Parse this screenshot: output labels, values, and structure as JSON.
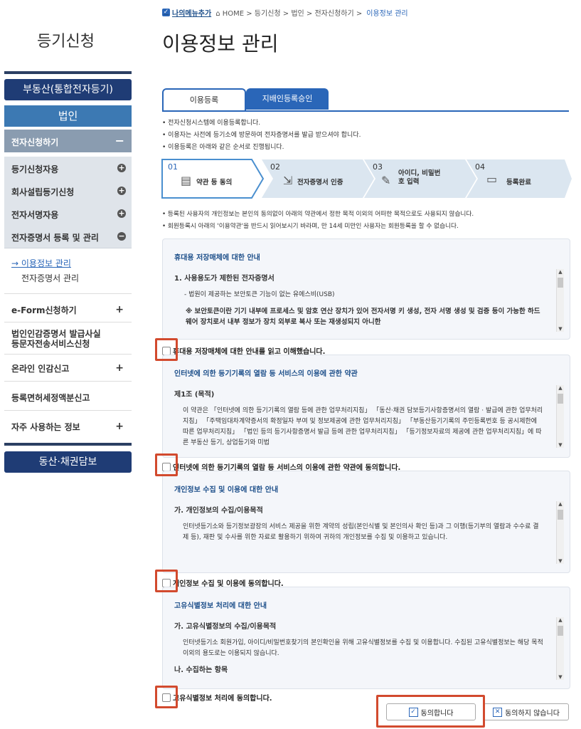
{
  "breadcrumb": {
    "mymenu": "나의메뉴추가",
    "path": "⌂ HOME > 등기신청 > 법인 > 전자신청하기 >",
    "current": "이용정보 관리"
  },
  "sidebar": {
    "title": "등기신청",
    "realestate": "부동산(통합전자등기)",
    "corporate": "법인",
    "esubmit": {
      "label": "전자신청하기",
      "toggle": "−"
    },
    "items": [
      {
        "label": "등기신청자용",
        "icon": "+"
      },
      {
        "label": "회사설립등기신청",
        "icon": "+"
      },
      {
        "label": "전자서명자용",
        "icon": "+"
      },
      {
        "label": "전자증명서 등록 및 관리",
        "icon": "−"
      }
    ],
    "sub": [
      {
        "label": "→ 이용정보 관리"
      },
      {
        "label": "전자증명서 관리"
      }
    ],
    "menus": [
      {
        "label": "e-Form신청하기",
        "plus": "+"
      },
      {
        "label": "법인인감증명서 발급사실\n등문자전송서비스신청",
        "plus": ""
      },
      {
        "label": "온라인 인감신고",
        "plus": "+"
      },
      {
        "label": "등록면허세정액분신고",
        "plus": ""
      },
      {
        "label": "자주 사용하는 정보",
        "plus": "+"
      }
    ],
    "movable": "동산·채권담보"
  },
  "main": {
    "title": "이용정보 관리",
    "tabs": [
      {
        "label": "이용등록"
      },
      {
        "label": "지배인등록승인"
      }
    ],
    "bullets": [
      "• 전자신청시스템에 이용등록합니다.",
      "• 이용자는 사전에 등기소에 방문하여 전자증명서를 발급 받으셔야 합니다.",
      "• 이용등록은 아래와 같은 순서로 진행됩니다."
    ],
    "steps": [
      {
        "num": "01",
        "label": "약관 등 동의",
        "icon": "document-icon"
      },
      {
        "num": "02",
        "label": "전자증명서 인증",
        "icon": "certificate-icon"
      },
      {
        "num": "03",
        "label": "아이디, 비밀번\n호 입력",
        "icon": "pen-icon"
      },
      {
        "num": "04",
        "label": "등록완료",
        "icon": "monitor-icon"
      }
    ],
    "notes": [
      "• 등록된 사용자의 개인정보는 본인의 동의없이 아래의 약관에서 정한 목적 이외의 어떠한 목적으로도 사용되지 않습니다.",
      "• 회원등록시 아래의 '이용약관'을 반드시 읽어보시기 바라며, 만 14세 미만인 사용자는 회원등록을 할 수 없습니다."
    ],
    "boxes": [
      {
        "title": "휴대용 저장매체에 대한 안내",
        "heading": "1. 사용용도가 제한된 전자증명서",
        "lines": [
          "- 법원이 제공하는 보안토큰 기능이 없는 유에스비(USB)"
        ],
        "note": "※ 보안토큰이란 기기 내부에 프로세스 및 암호 연산 장치가 있어 전자서명 키 생성, 전자 서명 생성 및 검증 등이 가능한 하드웨어 장치로서 내부 정보가 장치 외부로 복사 또는 재생성되지 아니한",
        "agree": "휴대용 저장매체에 대한 안내를 읽고 이해했습니다."
      },
      {
        "title": "인터넷에 의한 등기기록의 열람 등 서비스의 이용에 관한 약관",
        "heading": "제1조 (목적)",
        "lines": [
          "이 약관은 「인터넷에 의한 등기기록의 열람 등에 관한 업무처리지침」 「동산·채권 담보등기사항증명서의 열람 · 발급에 관한 업무처리지침」 「주택임대차계약증서의 확정일자 부여 및 정보제공에 관한 업무처리지침」 「부동산등기기록의 주민등록번호 등 공시제한에 따른 업무처리지침」 「법인 등의 등기사항증명서 발급 등에 관한 업무처리지침」 「등기정보자료의 제공에 관한 업무처리지침」에 따른 부동산 등기, 상업등기와 미법"
        ],
        "note": "",
        "agree": "인터넷에 의한 등기기록의 열람 등 서비스의 이용에 관한 약관에 동의합니다."
      },
      {
        "title": "개인정보 수집 및 이용에 대한 안내",
        "heading": "가. 개인정보의 수집/이용목적",
        "lines": [
          "인터넷등기소와 등기정보광장의 서비스 제공을 위한 계약의 성립(본인식별 및 본인의사 확인 등)과 그 이행(등기부의 열람과 수수료 결제 등), 재판 및 수사를 위한 자료로 활용하기 위하여 귀하의 개인정보를 수집 및 이용하고 있습니다."
        ],
        "note": "",
        "agree": "개인정보 수집 및 이용에 동의합니다."
      },
      {
        "title": "고유식별정보 처리에 대한 안내",
        "heading": "가. 고유식별정보의 수집/이용목적",
        "lines": [
          "인터넷등기소 회원가입, 아이디/비밀번호찾기의 본인확인을 위해 고유식별정보를 수집 및 이용합니다. 수집된 고유식별정보는 해당 목적이외의 용도로는 이용되지 않습니다."
        ],
        "note": "나. 수집하는 항목",
        "agree": "고유식별정보 처리에 동의합니다."
      }
    ],
    "agree_btn": "동의합니다",
    "disagree_btn": "동의하지 않습니다",
    "highlight_color": "#d24a2e"
  }
}
